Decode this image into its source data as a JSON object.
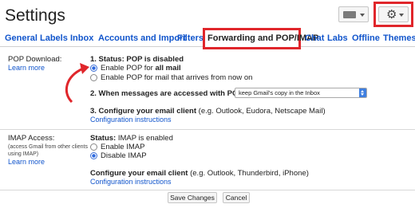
{
  "header": {
    "title": "Settings",
    "keyboard_icon": "keyboard-icon",
    "gear_icon": "gear-icon"
  },
  "tabs": [
    {
      "label": "General"
    },
    {
      "label": "Labels"
    },
    {
      "label": "Inbox"
    },
    {
      "label": "Accounts and Import"
    },
    {
      "label": "Filters"
    },
    {
      "label": "Forwarding and POP/IMAP",
      "active": true
    },
    {
      "label": "Chat"
    },
    {
      "label": "Labs"
    },
    {
      "label": "Offline"
    },
    {
      "label": "Themes"
    }
  ],
  "pop": {
    "section_label": "POP Download:",
    "learn_more": "Learn more",
    "status": "1. Status: POP is disabled",
    "option_all_prefix": "Enable POP for ",
    "option_all_bold": "all mail",
    "option_now": "Enable POP for mail that arrives from now on",
    "when_accessed": "2. When messages are accessed with POP",
    "select_value": "keep Gmail's copy in the Inbox",
    "configure_prefix": "3. Configure your email client",
    "configure_suffix": " (e.g. Outlook, Eudora, Netscape Mail)",
    "config_link": "Configuration instructions"
  },
  "imap": {
    "section_label": "IMAP Access:",
    "sub_line1": "(access Gmail from other clients",
    "sub_line2": "using IMAP)",
    "learn_more": "Learn more",
    "status_label": "Status: ",
    "status_value": "IMAP is enabled",
    "enable": "Enable IMAP",
    "disable": "Disable IMAP",
    "configure_prefix": "Configure your email client",
    "configure_suffix": " (e.g. Outlook, Thunderbird, iPhone)",
    "config_link": "Configuration instructions"
  },
  "footer": {
    "save": "Save Changes",
    "cancel": "Cancel"
  },
  "colors": {
    "highlight": "#e0262b",
    "link": "#1155cc",
    "radio_selected": "#2f6be0"
  }
}
